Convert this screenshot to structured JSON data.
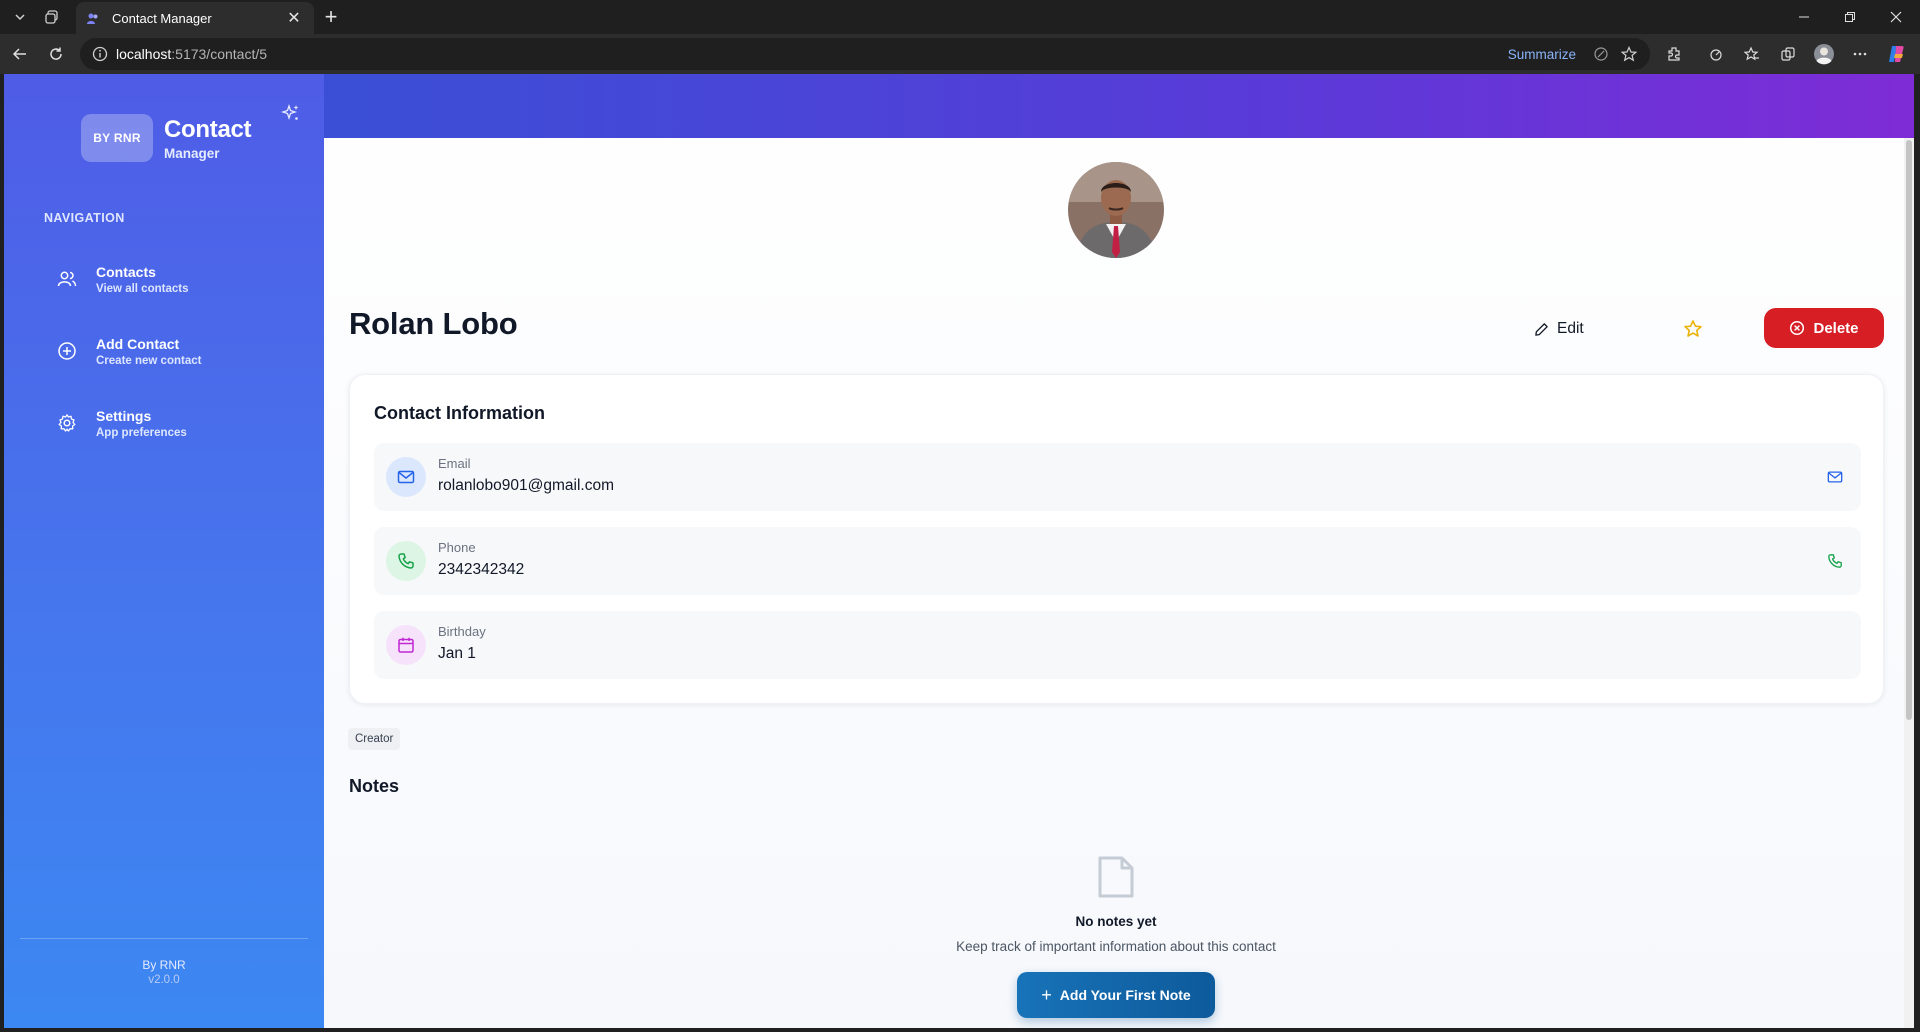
{
  "browser": {
    "tab_title": "Contact Manager",
    "url_host": "localhost",
    "url_path": ":5173/contact/5",
    "summarize_label": "Summarize"
  },
  "sidebar": {
    "badge": "BY RNR",
    "title": "Contact",
    "subtitle": "Manager",
    "nav_heading": "NAVIGATION",
    "items": [
      {
        "label": "Contacts",
        "sub": "View all contacts",
        "icon": "users-icon"
      },
      {
        "label": "Add Contact",
        "sub": "Create new contact",
        "icon": "plus-circle-icon"
      },
      {
        "label": "Settings",
        "sub": "App preferences",
        "icon": "gear-icon"
      }
    ],
    "footer_by": "By RNR",
    "footer_version": "v2.0.0"
  },
  "contact": {
    "name": "Rolan Lobo",
    "edit_label": "Edit",
    "delete_label": "Delete",
    "info_title": "Contact Information",
    "email_label": "Email",
    "email": "rolanlobo901@gmail.com",
    "phone_label": "Phone",
    "phone": "2342342342",
    "birthday_label": "Birthday",
    "birthday": "Jan 1",
    "tag": "Creator"
  },
  "notes": {
    "title": "Notes",
    "empty_title": "No notes yet",
    "empty_sub": "Keep track of important information about this contact",
    "add_label": "Add Your First Note"
  },
  "colors": {
    "delete": "#d71e24",
    "email_icon": "#2563eb",
    "phone_icon": "#16a34a",
    "birthday_icon": "#c026d3",
    "star": "#eab308",
    "add_note": "#1873b8"
  }
}
